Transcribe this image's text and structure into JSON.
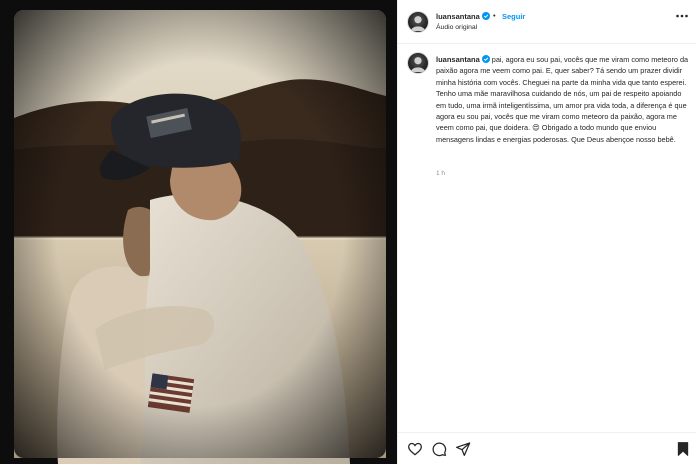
{
  "post": {
    "username": "luansantana",
    "follow_label": "Seguir",
    "separator": "•",
    "audio_label": "Áudio original",
    "caption": "pai, agora eu sou pai, vocês que me viram como meteoro da paixão agora me veem como pai. E, quer saber? Tá sendo um prazer dividir minha história com vocês. Cheguei na parte da minha vida que tanto esperei. Tenho uma mãe maravilhosa cuidando de nós, um pai de respeito apoiando em tudo, uma irmã inteligentíssima, um amor pra vida toda, a diferença é que agora eu sou pai, vocês que me viram como meteoro da paixão, agora me veem como pai, que doidera. 😍 Obrigado a todo mundo que enviou mensagens lindas e energias poderosas. Que Deus abençoe nosso bebê.",
    "time_ago": "1 h"
  },
  "icons": {
    "verified": "verified-badge-icon",
    "more": "more-options-icon",
    "like": "heart-icon",
    "comment": "comment-icon",
    "share": "send-icon",
    "save": "bookmark-icon"
  },
  "colors": {
    "accent": "#0095f6",
    "text": "#262626",
    "muted": "#8e8e8e",
    "border": "#efefef"
  }
}
